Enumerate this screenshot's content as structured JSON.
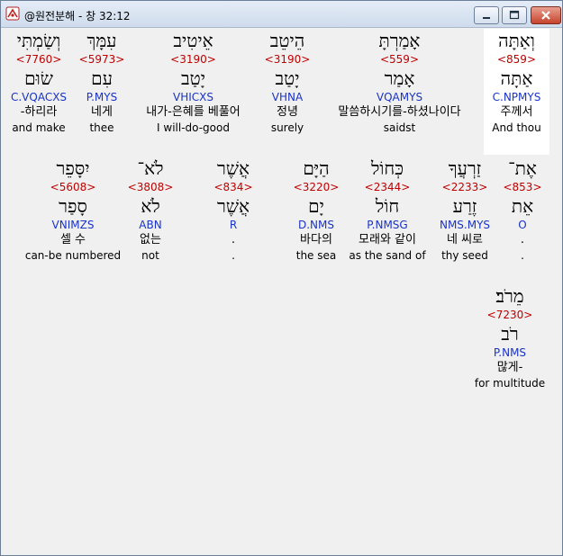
{
  "window": {
    "title": "@원전분해 - 창 32:12",
    "buttons": {
      "minimize": "minimize",
      "maximize": "maximize",
      "close": "close"
    }
  },
  "rows": [
    [
      {
        "heb": "וְאַתָּה",
        "num": "<859>",
        "lemma": "אַתָּה",
        "morph": "C.NPMYS",
        "kor": "주께서",
        "eng": "And thou",
        "selected": true
      },
      {
        "heb": "אָמַרְתָּ",
        "num": "<559>",
        "lemma": "אָמַר",
        "morph": "VQAMYS",
        "kor": "말씀하시기를-하셨나이다",
        "eng": "saidst",
        "selected": false
      },
      {
        "heb": "הֵיטֵב",
        "num": "<3190>",
        "lemma": "יָטַב",
        "morph": "VHNA",
        "kor": "정녕",
        "eng": "surely",
        "selected": false
      },
      {
        "heb": "אֵיטִיב",
        "num": "<3190>",
        "lemma": "יָטַב",
        "morph": "VHICXS",
        "kor": "내가-은혜를 베풀어",
        "eng": "I will-do-good",
        "selected": false
      },
      {
        "heb": "עִמָּךְ",
        "num": "<5973>",
        "lemma": "עִם",
        "morph": "P.MYS",
        "kor": "네게",
        "eng": "thee",
        "selected": false
      },
      {
        "heb": "וְשַׂמְתִּי",
        "num": "<7760>",
        "lemma": "שׂוּם",
        "morph": "C.VQACXS",
        "kor": "-하리라",
        "eng": "and make",
        "selected": false
      }
    ],
    [
      {
        "heb": "אֶת־",
        "num": "<853>",
        "lemma": "אֵת",
        "morph": "O",
        "kor": ".",
        "eng": ".",
        "selected": false
      },
      {
        "heb": "זַרְעֲךָ",
        "num": "<2233>",
        "lemma": "זֶרַע",
        "morph": "NMS.MYS",
        "kor": "네 씨로",
        "eng": "thy seed",
        "selected": false
      },
      {
        "heb": "כְּחוֹל",
        "num": "<2344>",
        "lemma": "חוֹל",
        "morph": "P.NMSG",
        "kor": "모래와 같이",
        "eng": "as the sand of",
        "selected": false
      },
      {
        "heb": "הַיָּם",
        "num": "<3220>",
        "lemma": "יָם",
        "morph": "D.NMS",
        "kor": "바다의",
        "eng": "the sea",
        "selected": false
      },
      {
        "heb": "אֲשֶׁר",
        "num": "<834>",
        "lemma": "אֲשֶׁר",
        "morph": "R",
        "kor": ".",
        "eng": ".",
        "selected": false
      },
      {
        "heb": "לֹא־",
        "num": "<3808>",
        "lemma": "לֹא",
        "morph": "ABN",
        "kor": "없는",
        "eng": "not",
        "selected": false
      },
      {
        "heb": "יִסָּפֵר",
        "num": "<5608>",
        "lemma": "סָפַר",
        "morph": "VNIMZS",
        "kor": "셀 수",
        "eng": "can-be numbered",
        "selected": false
      }
    ],
    [
      {
        "heb": "מֵרֹב׃",
        "num": "<7230>",
        "lemma": "רֹב",
        "morph": "P.NMS",
        "kor": "많게-",
        "eng": "for multitude",
        "selected": false
      }
    ]
  ]
}
